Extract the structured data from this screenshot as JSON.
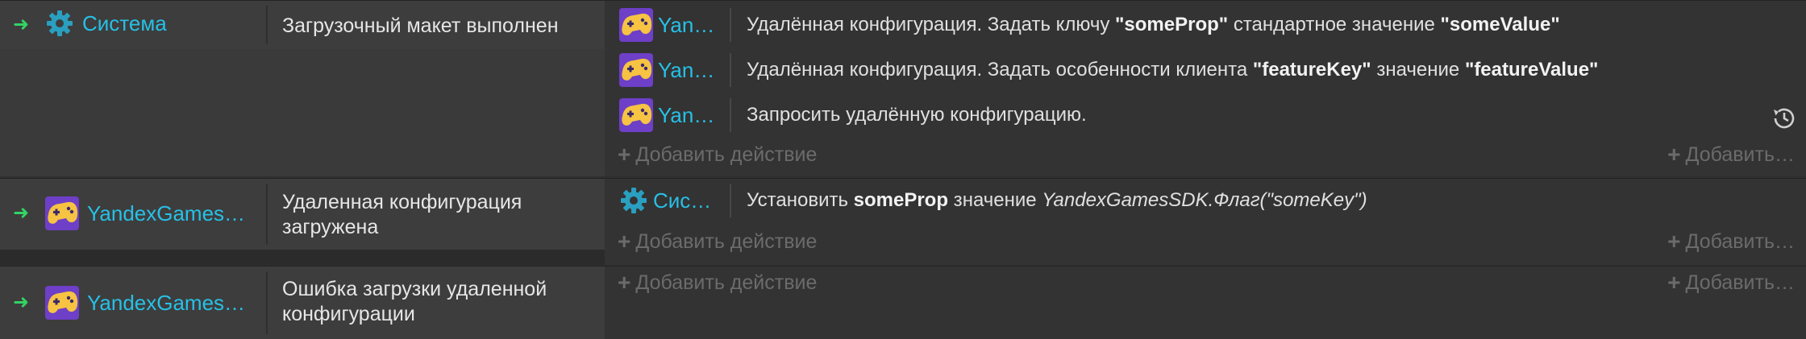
{
  "events": [
    {
      "object": "Система",
      "condition": "Загрузочный макет выполнен",
      "actions": [
        {
          "object": "Yan…",
          "parts": [
            {
              "t": "Удалённая конфигурация. Задать ключу ",
              "s": "n"
            },
            {
              "t": "\"someProp\"",
              "s": "b"
            },
            {
              "t": " стандартное значение ",
              "s": "n"
            },
            {
              "t": "\"someValue\"",
              "s": "b"
            }
          ]
        },
        {
          "object": "Yan…",
          "parts": [
            {
              "t": "Удалённая конфигурация. Задать особенности клиента ",
              "s": "n"
            },
            {
              "t": "\"featureKey\"",
              "s": "b"
            },
            {
              "t": " значение ",
              "s": "n"
            },
            {
              "t": "\"featureValue\"",
              "s": "b"
            }
          ]
        },
        {
          "object": "Yan…",
          "parts": [
            {
              "t": "Запросить удалённую конфигурацию.",
              "s": "n"
            }
          ]
        }
      ],
      "add_action": "Добавить действие",
      "add_right": "Добавить…"
    },
    {
      "object": "YandexGames…",
      "condition": "Удаленная конфигурация загружена",
      "actions": [
        {
          "object": "Сис…",
          "parts": [
            {
              "t": "Установить ",
              "s": "n"
            },
            {
              "t": "someProp",
              "s": "b"
            },
            {
              "t": " значение ",
              "s": "n"
            },
            {
              "t": "YandexGamesSDK.Флаг(\"someKey\")",
              "s": "i"
            }
          ]
        }
      ],
      "add_action": "Добавить действие",
      "add_right": "Добавить…"
    },
    {
      "object": "YandexGames…",
      "condition": "Ошибка загрузки удаленной конфигурации",
      "actions": [],
      "add_action": "Добавить действие",
      "add_right": "Добавить…"
    }
  ],
  "colors": {
    "object_name": "#27c0e6",
    "condition_arrow": "#32d464",
    "add_text": "#6b6b6b"
  }
}
